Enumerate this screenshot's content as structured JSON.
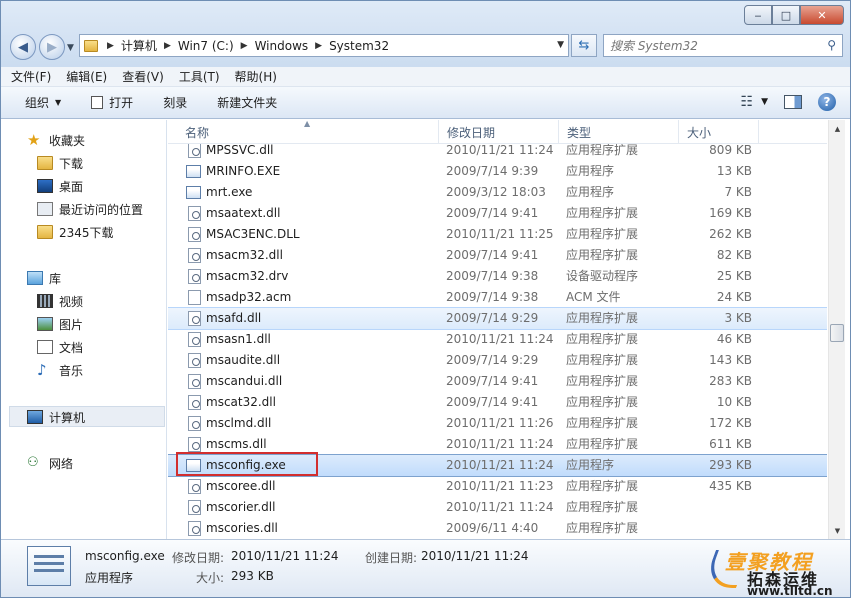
{
  "window": {
    "caption": {
      "minimize": "‒",
      "maximize": "□",
      "close": "✕"
    }
  },
  "nav": {
    "back_icon": "back-arrow-icon",
    "forward_icon": "forward-arrow-icon"
  },
  "address": {
    "crumbs": [
      "计算机",
      "Win7 (C:)",
      "Windows",
      "System32"
    ]
  },
  "search": {
    "placeholder": "搜索 System32"
  },
  "menu": [
    "文件(F)",
    "编辑(E)",
    "查看(V)",
    "工具(T)",
    "帮助(H)"
  ],
  "toolbar": {
    "organize": "组织",
    "open": "打开",
    "burn": "刻录",
    "new_folder": "新建文件夹"
  },
  "navpane": {
    "favorites": "收藏夹",
    "downloads": "下载",
    "desktop": "桌面",
    "recent": "最近访问的位置",
    "downloads2345": "2345下载",
    "libraries": "库",
    "videos": "视频",
    "pictures": "图片",
    "documents": "文档",
    "music": "音乐",
    "computer": "计算机",
    "network": "网络"
  },
  "columns": {
    "name": "名称",
    "date": "修改日期",
    "type": "类型",
    "size": "大小"
  },
  "files": [
    {
      "name": "MPSSVC.dll",
      "date": "2010/11/21 11:24",
      "type": "应用程序扩展",
      "size": "809 KB",
      "kind": "dll"
    },
    {
      "name": "MRINFO.EXE",
      "date": "2009/7/14 9:39",
      "type": "应用程序",
      "size": "13 KB",
      "kind": "exe"
    },
    {
      "name": "mrt.exe",
      "date": "2009/3/12 18:03",
      "type": "应用程序",
      "size": "7 KB",
      "kind": "exe"
    },
    {
      "name": "msaatext.dll",
      "date": "2009/7/14 9:41",
      "type": "应用程序扩展",
      "size": "169 KB",
      "kind": "dll"
    },
    {
      "name": "MSAC3ENC.DLL",
      "date": "2010/11/21 11:25",
      "type": "应用程序扩展",
      "size": "262 KB",
      "kind": "dll"
    },
    {
      "name": "msacm32.dll",
      "date": "2009/7/14 9:41",
      "type": "应用程序扩展",
      "size": "82 KB",
      "kind": "dll"
    },
    {
      "name": "msacm32.drv",
      "date": "2009/7/14 9:38",
      "type": "设备驱动程序",
      "size": "25 KB",
      "kind": "dll"
    },
    {
      "name": "msadp32.acm",
      "date": "2009/7/14 9:38",
      "type": "ACM 文件",
      "size": "24 KB",
      "kind": "file"
    },
    {
      "name": "msafd.dll",
      "date": "2009/7/14 9:29",
      "type": "应用程序扩展",
      "size": "3 KB",
      "kind": "dll"
    },
    {
      "name": "msasn1.dll",
      "date": "2010/11/21 11:24",
      "type": "应用程序扩展",
      "size": "46 KB",
      "kind": "dll"
    },
    {
      "name": "msaudite.dll",
      "date": "2009/7/14 9:29",
      "type": "应用程序扩展",
      "size": "143 KB",
      "kind": "dll"
    },
    {
      "name": "mscandui.dll",
      "date": "2009/7/14 9:41",
      "type": "应用程序扩展",
      "size": "283 KB",
      "kind": "dll"
    },
    {
      "name": "mscat32.dll",
      "date": "2009/7/14 9:41",
      "type": "应用程序扩展",
      "size": "10 KB",
      "kind": "dll"
    },
    {
      "name": "msclmd.dll",
      "date": "2010/11/21 11:26",
      "type": "应用程序扩展",
      "size": "172 KB",
      "kind": "dll"
    },
    {
      "name": "mscms.dll",
      "date": "2010/11/21 11:24",
      "type": "应用程序扩展",
      "size": "611 KB",
      "kind": "dll"
    },
    {
      "name": "msconfig.exe",
      "date": "2010/11/21 11:24",
      "type": "应用程序",
      "size": "293 KB",
      "kind": "exe"
    },
    {
      "name": "mscoree.dll",
      "date": "2010/11/21 11:23",
      "type": "应用程序扩展",
      "size": "435 KB",
      "kind": "dll"
    },
    {
      "name": "mscorier.dll",
      "date": "2010/11/21 11:24",
      "type": "应用程序扩展",
      "size": "",
      "kind": "dll"
    },
    {
      "name": "mscories.dll",
      "date": "2009/6/11 4:40",
      "type": "应用程序扩展",
      "size": "",
      "kind": "dll"
    }
  ],
  "details": {
    "name": "msconfig.exe",
    "type": "应用程序",
    "modified_label": "修改日期:",
    "modified": "2010/11/21 11:24",
    "size_label": "大小:",
    "size": "293 KB",
    "created_label": "创建日期:",
    "created": "2010/11/21 11:24"
  },
  "watermark": {
    "top": "壹聚教程",
    "mid": "拓森运维",
    "url": "www.tlltd.cn"
  },
  "colors": {
    "selection_outline": "#7da2ce",
    "highlight_box": "#d22e2e",
    "watermark_orange": "#f3a021"
  }
}
